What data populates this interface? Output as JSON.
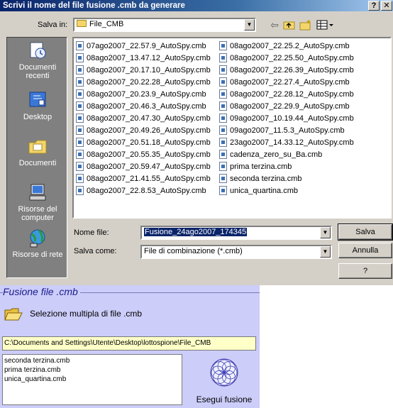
{
  "dialog": {
    "title": "Scrivi il nome del file fusione .cmb da generare",
    "help_glyph": "?",
    "close_glyph": "✕",
    "save_in_label": "Salva in:",
    "save_in_value": "File_CMB",
    "toolbar_icons": [
      "back-icon",
      "up-folder-icon",
      "new-folder-icon",
      "view-menu-icon"
    ],
    "places": [
      "Documenti recenti",
      "Desktop",
      "Documenti",
      "Risorse del computer",
      "Risorse di rete"
    ],
    "files_col1": [
      "07ago2007_22.57.9_AutoSpy.cmb",
      "08ago2007_13.47.12_AutoSpy.cmb",
      "08ago2007_20.17.10_AutoSpy.cmb",
      "08ago2007_20.22.28_AutoSpy.cmb",
      "08ago2007_20.23.9_AutoSpy.cmb",
      "08ago2007_20.46.3_AutoSpy.cmb",
      "08ago2007_20.47.30_AutoSpy.cmb",
      "08ago2007_20.49.26_AutoSpy.cmb",
      "08ago2007_20.51.18_AutoSpy.cmb",
      "08ago2007_20.55.35_AutoSpy.cmb",
      "08ago2007_20.59.47_AutoSpy.cmb",
      "08ago2007_21.41.55_AutoSpy.cmb",
      "08ago2007_22.8.53_AutoSpy.cmb"
    ],
    "files_col2": [
      "08ago2007_22.25.2_AutoSpy.cmb",
      "08ago2007_22.25.50_AutoSpy.cmb",
      "08ago2007_22.26.39_AutoSpy.cmb",
      "08ago2007_22.27.4_AutoSpy.cmb",
      "08ago2007_22.28.12_AutoSpy.cmb",
      "08ago2007_22.29.9_AutoSpy.cmb",
      "09ago2007_10.19.44_AutoSpy.cmb",
      "09ago2007_11.5.3_AutoSpy.cmb",
      "23ago2007_14.33.12_AutoSpy.cmb",
      "cadenza_zero_su_Ba.cmb",
      "prima terzina.cmb",
      "seconda terzina.cmb",
      "unica_quartina.cmb"
    ],
    "filename_label": "Nome file:",
    "filename_value": "Fusione_24ago2007_174345",
    "saveas_label": "Salva come:",
    "saveas_value": "File di combinazione (*.cmb)",
    "save_button": "Salva",
    "cancel_button": "Annulla",
    "help_button": "?"
  },
  "panel": {
    "title": "Fusione file .cmb",
    "multi_select_label": "Selezione multipla di file .cmb",
    "path": "C:\\Documents and Settings\\Utente\\Desktop\\lottospione\\File_CMB",
    "selected_files": [
      "seconda terzina.cmb",
      "prima terzina.cmb",
      "unica_quartina.cmb"
    ],
    "execute_label": "Esegui fusione"
  },
  "colors": {
    "titlebar_start": "#0a246a",
    "dialog_bg": "#d4d0c8",
    "places_bg": "#808080",
    "panel_bg": "#cccdf9",
    "path_bg": "#ffffc8"
  }
}
